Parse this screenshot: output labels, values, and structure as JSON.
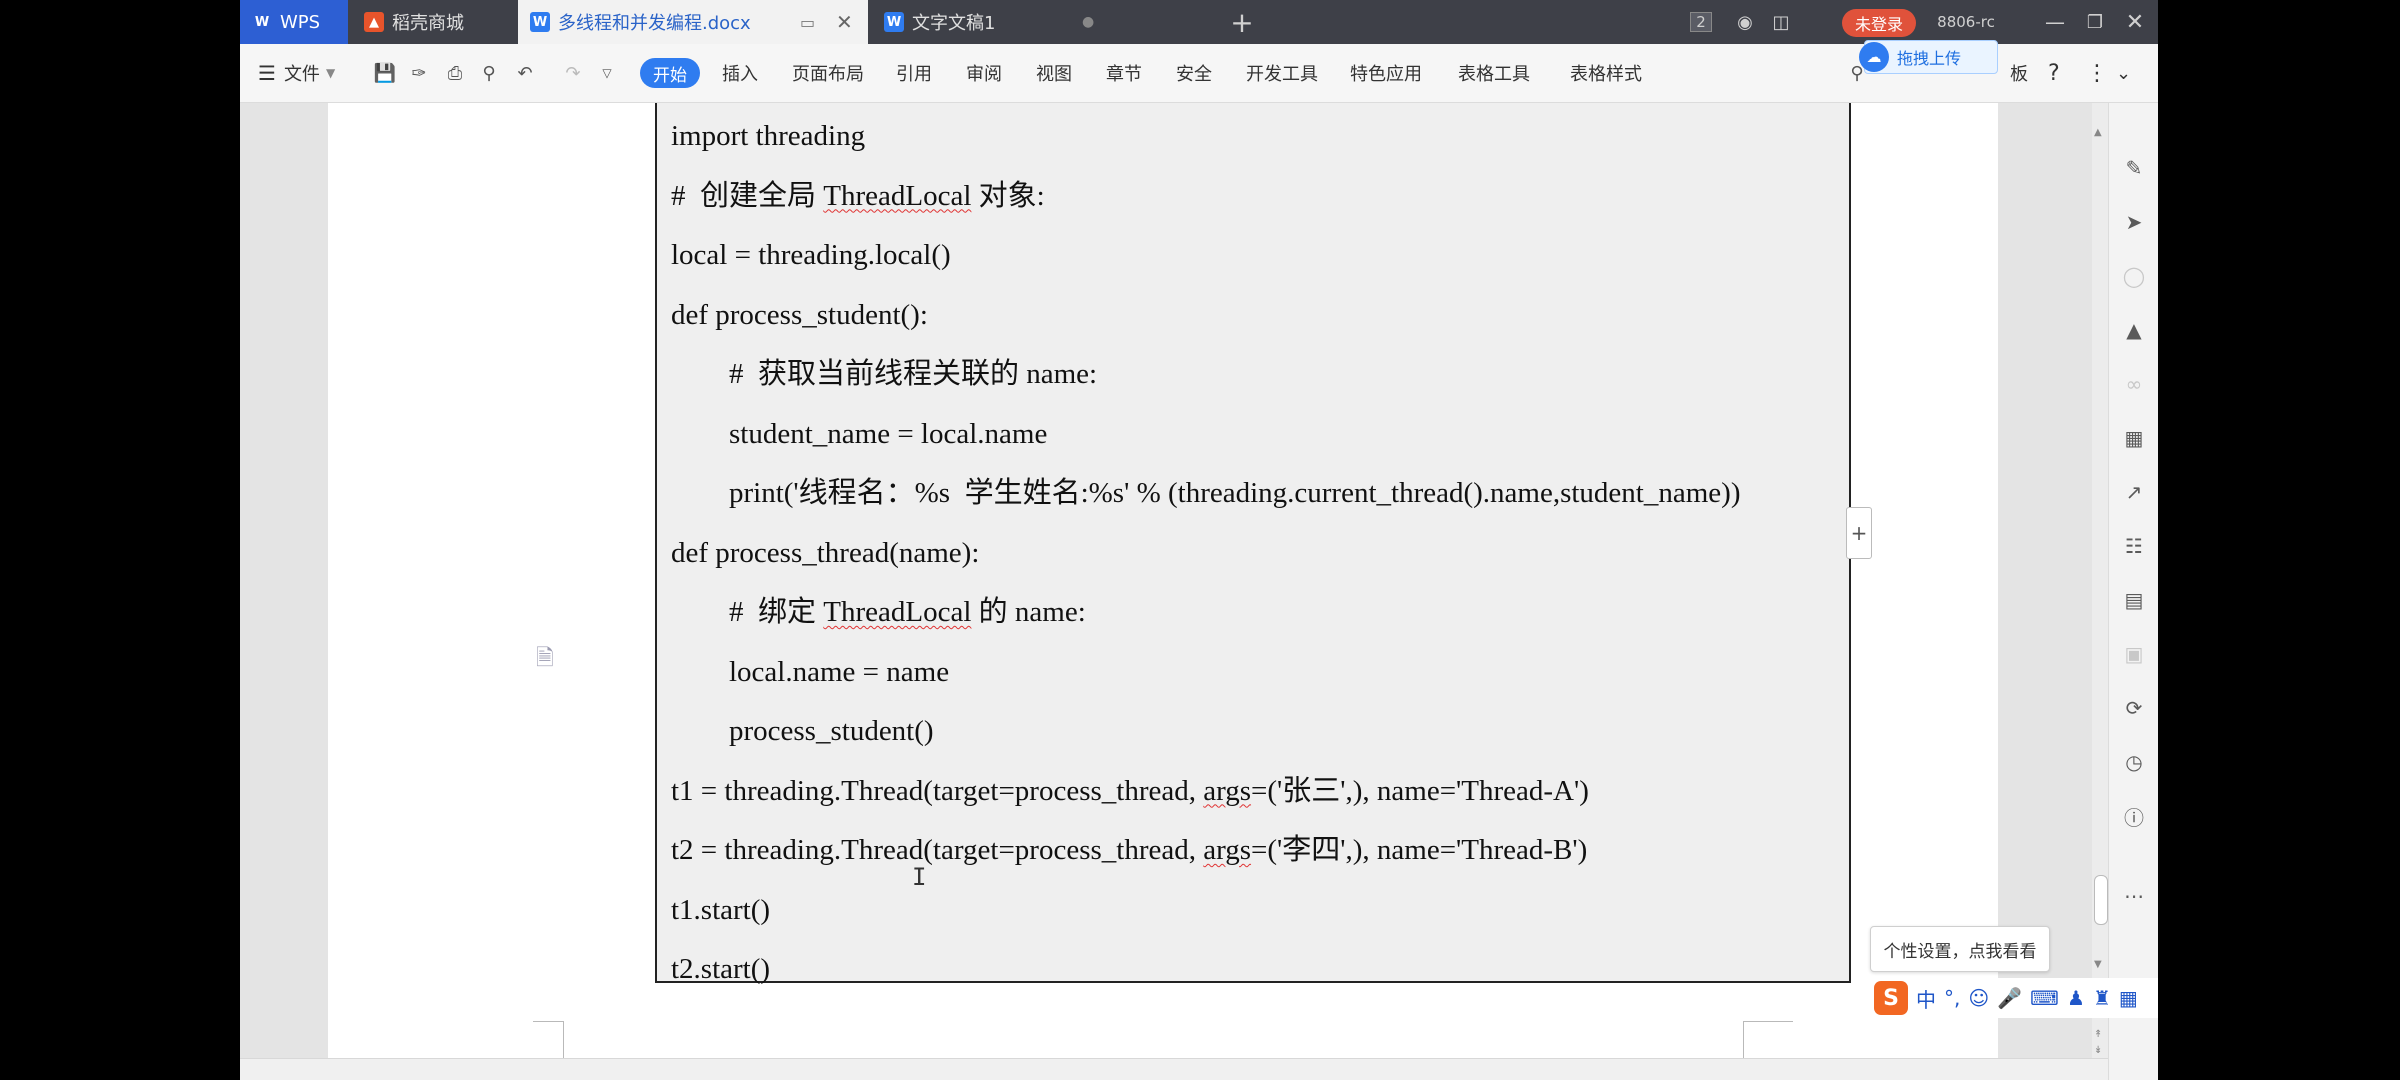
{
  "titlebar": {
    "tabs": [
      {
        "label": "WPS",
        "icon": "wps-logo-icon"
      },
      {
        "label": "稻壳商城",
        "icon": "docer-flame-icon"
      },
      {
        "label": "多线程和并发编程.docx",
        "icon": "word-doc-icon",
        "active": true
      },
      {
        "label": "文字文稿1",
        "icon": "word-doc-icon"
      }
    ],
    "window_count": "2",
    "login_label": "未登录",
    "user_label": "8806-rc"
  },
  "toolbar": {
    "file_label": "文件",
    "menus": [
      "开始",
      "插入",
      "页面布局",
      "引用",
      "审阅",
      "视图",
      "章节",
      "安全",
      "开发工具",
      "特色应用",
      "表格工具",
      "表格样式"
    ],
    "upload_tip": "拖拽上传",
    "overflow_text": "板",
    "help": "?"
  },
  "code": {
    "lines": [
      {
        "indent": 0,
        "segments": [
          {
            "t": "import threading"
          }
        ]
      },
      {
        "indent": 0,
        "segments": [
          {
            "t": "#  创建全局 "
          },
          {
            "t": "ThreadLocal",
            "squig": true
          },
          {
            "t": " 对象:"
          }
        ]
      },
      {
        "indent": 0,
        "segments": [
          {
            "t": "local = threading.local()"
          }
        ]
      },
      {
        "indent": 0,
        "segments": [
          {
            "t": "def process_student():"
          }
        ]
      },
      {
        "indent": 1,
        "segments": [
          {
            "t": "#  获取当前线程关联的 name:"
          }
        ]
      },
      {
        "indent": 1,
        "segments": [
          {
            "t": "student_name = local.name"
          }
        ]
      },
      {
        "indent": 1,
        "segments": [
          {
            "t": "print('线程名：%s  学生姓名:%s' % (threading.current_thread().name,student_name))"
          }
        ]
      },
      {
        "indent": 0,
        "segments": [
          {
            "t": "def process_thread(name):"
          }
        ]
      },
      {
        "indent": 1,
        "segments": [
          {
            "t": "#  绑定 "
          },
          {
            "t": "ThreadLocal",
            "squig": true
          },
          {
            "t": " 的 name:"
          }
        ]
      },
      {
        "indent": 1,
        "segments": [
          {
            "t": "local.name = name"
          }
        ]
      },
      {
        "indent": 1,
        "segments": [
          {
            "t": "process_student()"
          }
        ]
      },
      {
        "indent": 0,
        "segments": [
          {
            "t": "t1 = threading.Thread(target=process_thread, "
          },
          {
            "t": "args",
            "squig": true
          },
          {
            "t": "=('张三',), name='Thread-A')"
          }
        ]
      },
      {
        "indent": 0,
        "segments": [
          {
            "t": "t2 = threading.Thread(target=process_thread, "
          },
          {
            "t": "args",
            "squig": true
          },
          {
            "t": "=('李四',), name='Thread-B')"
          }
        ]
      },
      {
        "indent": 0,
        "segments": [
          {
            "t": "t1.start()"
          }
        ]
      },
      {
        "indent": 0,
        "segments": [
          {
            "t": "t2.start()"
          }
        ]
      }
    ]
  },
  "ime": {
    "tip": "个性设置，点我看看",
    "mode_label": "中",
    "punct_label": "°,"
  },
  "colors": {
    "accent": "#2f7cf0",
    "login": "#e0523b",
    "titlebar": "#3e4048",
    "ime_logo": "#f26722"
  }
}
